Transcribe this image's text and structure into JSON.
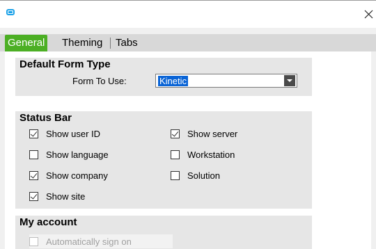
{
  "window": {
    "icon": "app-window-icon",
    "close_icon": "close-icon"
  },
  "tabs": [
    {
      "label": "General",
      "active": true
    },
    {
      "label": "Theming",
      "active": false
    },
    {
      "label": "Tabs",
      "active": false
    }
  ],
  "default_form_type": {
    "title": "Default Form Type",
    "form_to_use_label": "Form To Use:",
    "form_to_use_value": "Kinetic"
  },
  "status_bar": {
    "title": "Status Bar",
    "options": [
      {
        "label": "Show user ID",
        "checked": true
      },
      {
        "label": "Show server",
        "checked": true
      },
      {
        "label": "Show language",
        "checked": false
      },
      {
        "label": "Workstation",
        "checked": false
      },
      {
        "label": "Show company",
        "checked": true
      },
      {
        "label": "Solution",
        "checked": false
      },
      {
        "label": "Show site",
        "checked": true
      }
    ]
  },
  "my_account": {
    "title": "My account",
    "auto_sign_on_label": "Automatically sign on",
    "auto_sign_on_checked": false
  },
  "colors": {
    "active_tab": "#4caf24",
    "selection": "#0a64d6",
    "app_icon": "#1aa1e8"
  }
}
